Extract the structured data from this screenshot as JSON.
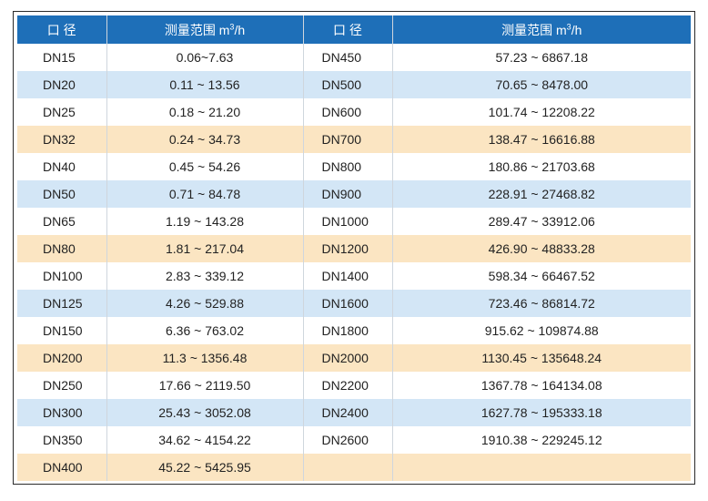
{
  "header": {
    "col1": "口 径",
    "col2_base": "测量范围 m",
    "col2_sup": "3",
    "col2_unit": "/h",
    "col3": "口 径",
    "col4_base": "测量范围 m",
    "col4_sup": "3",
    "col4_unit": "/h"
  },
  "rows": [
    {
      "style": "white",
      "dn1": "DN15",
      "range1": "0.06~7.63",
      "dn2": "DN450",
      "range2": "57.23 ~ 6867.18"
    },
    {
      "style": "blue",
      "dn1": "DN20",
      "range1": "0.11 ~ 13.56",
      "dn2": "DN500",
      "range2": "70.65 ~ 8478.00"
    },
    {
      "style": "white",
      "dn1": "DN25",
      "range1": "0.18 ~ 21.20",
      "dn2": "DN600",
      "range2": "101.74 ~ 12208.22"
    },
    {
      "style": "orange",
      "dn1": "DN32",
      "range1": "0.24 ~ 34.73",
      "dn2": "DN700",
      "range2": "138.47 ~ 16616.88"
    },
    {
      "style": "white",
      "dn1": "DN40",
      "range1": "0.45 ~ 54.26",
      "dn2": "DN800",
      "range2": "180.86 ~ 21703.68"
    },
    {
      "style": "blue",
      "dn1": "DN50",
      "range1": "0.71 ~ 84.78",
      "dn2": "DN900",
      "range2": "228.91 ~ 27468.82"
    },
    {
      "style": "white",
      "dn1": "DN65",
      "range1": "1.19 ~ 143.28",
      "dn2": "DN1000",
      "range2": "289.47 ~ 33912.06"
    },
    {
      "style": "orange",
      "dn1": "DN80",
      "range1": "1.81 ~ 217.04",
      "dn2": "DN1200",
      "range2": "426.90 ~ 48833.28"
    },
    {
      "style": "white",
      "dn1": "DN100",
      "range1": "2.83 ~ 339.12",
      "dn2": "DN1400",
      "range2": "598.34 ~ 66467.52"
    },
    {
      "style": "blue",
      "dn1": "DN125",
      "range1": "4.26 ~ 529.88",
      "dn2": "DN1600",
      "range2": "723.46 ~ 86814.72"
    },
    {
      "style": "white",
      "dn1": "DN150",
      "range1": "6.36 ~ 763.02",
      "dn2": "DN1800",
      "range2": "915.62 ~ 109874.88"
    },
    {
      "style": "orange",
      "dn1": "DN200",
      "range1": "11.3 ~ 1356.48",
      "dn2": "DN2000",
      "range2": "1130.45 ~ 135648.24"
    },
    {
      "style": "white",
      "dn1": "DN250",
      "range1": "17.66 ~ 2119.50",
      "dn2": "DN2200",
      "range2": "1367.78 ~ 164134.08"
    },
    {
      "style": "blue",
      "dn1": "DN300",
      "range1": "25.43 ~ 3052.08",
      "dn2": "DN2400",
      "range2": "1627.78 ~ 195333.18"
    },
    {
      "style": "white",
      "dn1": "DN350",
      "range1": "34.62 ~ 4154.22",
      "dn2": "DN2600",
      "range2": "1910.38 ~ 229245.12"
    },
    {
      "style": "orange",
      "dn1": "DN400",
      "range1": "45.22 ~ 5425.95",
      "dn2": "",
      "range2": ""
    }
  ],
  "colors": {
    "header_bg": "#1e6fb8",
    "row_blue": "#d3e6f6",
    "row_orange": "#fbe5c2",
    "row_white": "#ffffff"
  }
}
